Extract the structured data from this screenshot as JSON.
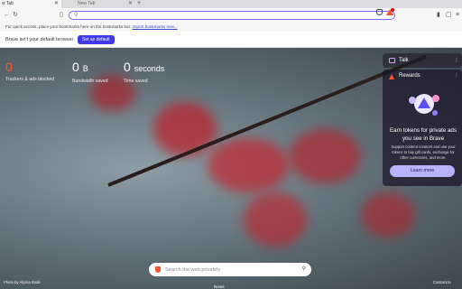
{
  "tabs": [
    {
      "label": "w Tab",
      "active": true
    },
    {
      "label": "New Tab",
      "active": false
    }
  ],
  "toolbar": {
    "omnibox_value": "",
    "icons": [
      "back-arrow-icon",
      "reload-icon",
      "bookmark-icon",
      "brave-shield-icon",
      "rewards-icon",
      "sidebar-icon",
      "extensions-icon",
      "menu-icon"
    ]
  },
  "bookmarks_bar": {
    "text": "For quick access, place your bookmarks here on the bookmarks bar.",
    "link": "Import bookmarks now..."
  },
  "infobar": {
    "message": "Brave isn't your default browser",
    "button": "Set as default"
  },
  "stats": {
    "trackers": {
      "value": "0",
      "label": "Trackers & ads blocked"
    },
    "bandwidth": {
      "value": "0",
      "unit": "B",
      "label": "Bandwidth saved"
    },
    "time": {
      "value": "0",
      "unit": "seconds",
      "label": "Time saved"
    }
  },
  "widgets": {
    "talk": {
      "label": "Talk"
    },
    "rewards": {
      "label": "Rewards",
      "title": "Earn tokens for private ads you see in Brave",
      "description": "Support content creators and use your tokens to buy gift cards, exchange for other currencies, and more.",
      "button": "Learn more"
    }
  },
  "search": {
    "placeholder": "Search the web privately"
  },
  "footer": {
    "photo_credit": "Photo by Alyssa Bode",
    "customize": "Customize",
    "news": "News"
  },
  "colors": {
    "accent": "#3f39e8",
    "brave_orange": "#fb542b"
  }
}
